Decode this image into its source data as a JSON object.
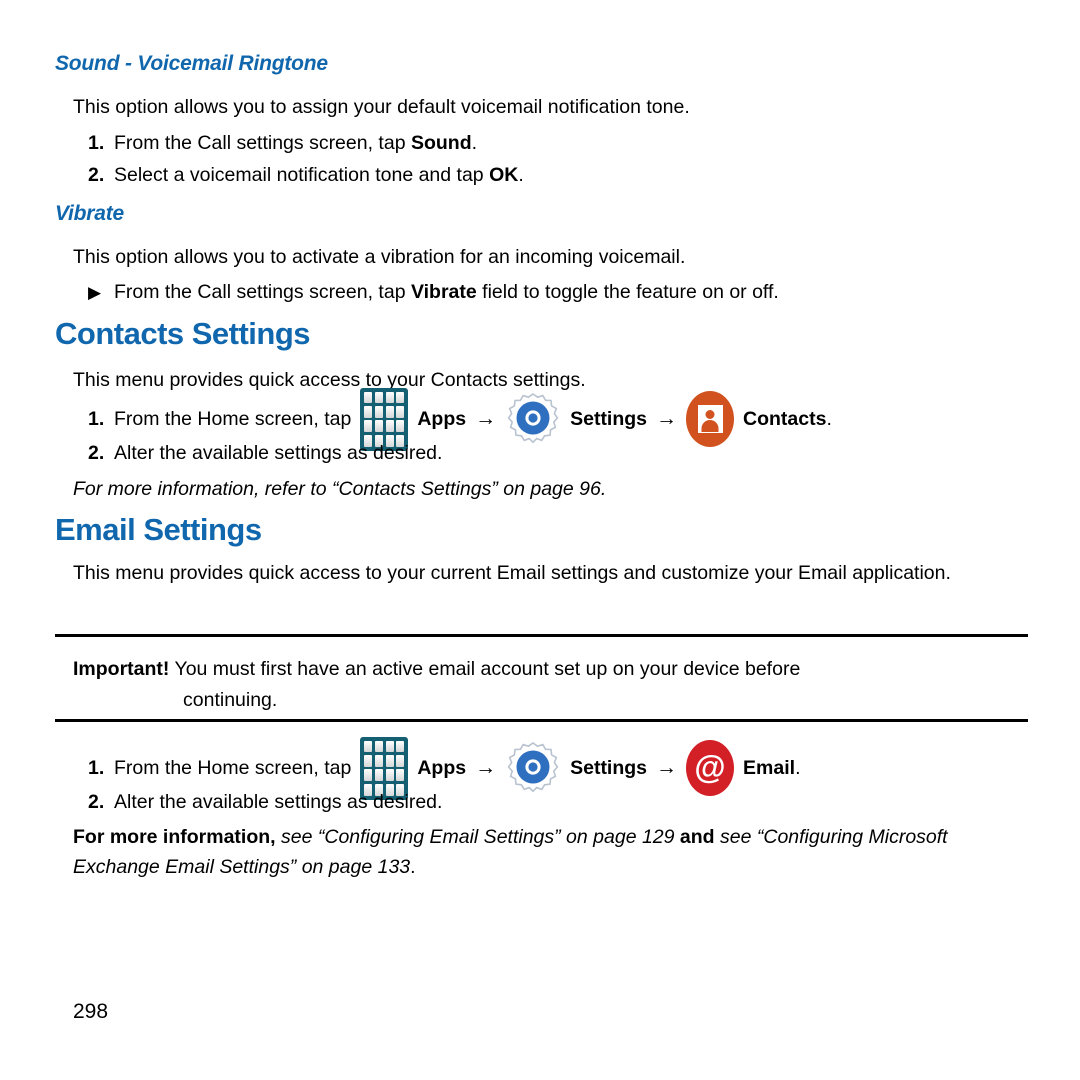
{
  "document": {
    "page_number": "298",
    "accent_color": "#1167ad",
    "rule_color": "#000000"
  },
  "sections": [
    {
      "heading": "Sound - Voicemail Ringtone",
      "intro": "This option allows you to assign your default voicemail notification tone.",
      "steps": [
        {
          "num": "1.",
          "pre": "From the Call settings screen, tap ",
          "bold": "Sound",
          "post": "."
        },
        {
          "num": "2.",
          "pre": "Select a voicemail notification tone and tap ",
          "bold": "OK",
          "post": "."
        }
      ]
    },
    {
      "heading": "Vibrate",
      "intro": "This option allows you to activate a vibration for an incoming voicemail.",
      "bullet": {
        "marker": "▶",
        "pre": "From the Call settings screen, tap ",
        "bold": "Vibrate",
        "post": " field to toggle the feature on or off."
      }
    }
  ],
  "contacts_settings": {
    "heading": "Contacts Settings",
    "intro": "This menu provides quick access to your Contacts settings.",
    "step1": {
      "num": "1.",
      "text_before": "From the Home screen, tap",
      "apps_label": "Apps",
      "arrow1": "→",
      "settings_label": "Settings",
      "arrow2": "→",
      "target_label": "Contacts",
      "period": ".",
      "icons": {
        "apps": "apps-grid-icon",
        "settings": "settings-gear-icon",
        "target": "contacts-icon"
      }
    },
    "step2": {
      "num": "2.",
      "text": "Alter the available settings as desired."
    },
    "crossref": "For more information, refer to “Contacts Settings” on page 96."
  },
  "email_settings": {
    "heading": "Email Settings",
    "intro": "This menu provides quick access to your current Email settings and customize your Email application.",
    "important": {
      "label": "Important!",
      "text": "You must first have an active email account set up on your device before",
      "continuation": "continuing."
    },
    "step1": {
      "num": "1.",
      "text_before": "From the Home screen, tap",
      "apps_label": "Apps",
      "arrow1": "→",
      "settings_label": "Settings",
      "arrow2": "→",
      "target_label": "Email",
      "period": ".",
      "icons": {
        "apps": "apps-grid-icon",
        "settings": "settings-gear-icon",
        "target": "email-at-icon"
      }
    },
    "step2": {
      "num": "2.",
      "text": "Alter the available settings as desired."
    },
    "crossref": {
      "lead": "For more information,",
      "ref1": " see “Configuring Email Settings” on page 129 ",
      "conj": "and",
      "ref2": " see “Configuring Microsoft Exchange Email Settings” on page 133",
      "period": "."
    }
  },
  "icons": {
    "email_glyph": "@"
  }
}
